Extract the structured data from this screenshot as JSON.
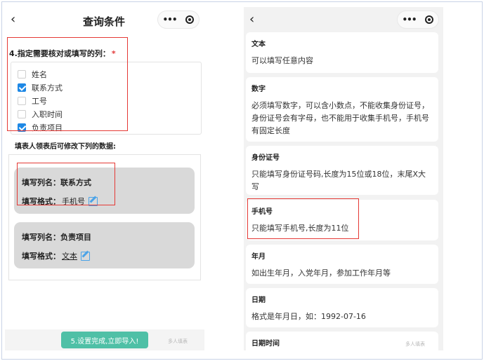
{
  "left": {
    "nav": {
      "back_icon": "back-arrow-icon",
      "title": "查询条件",
      "capsule_more": "menu-dots-icon",
      "capsule_close": "target-icon"
    },
    "question": {
      "label": "4.指定需要核对或填写的列：",
      "required_mark": "*"
    },
    "columns": [
      {
        "label": "姓名",
        "checked": false
      },
      {
        "label": "联系方式",
        "checked": true
      },
      {
        "label": "工号",
        "checked": false
      },
      {
        "label": "入职时间",
        "checked": false
      },
      {
        "label": "负责项目",
        "checked": true
      }
    ],
    "modify_label": "填表人领表后可修改下列的数据:",
    "cards": [
      {
        "name_label": "填写列名：",
        "name_value": "联系方式",
        "format_label": "填写格式：",
        "format_value": "手机号",
        "edit_icon": "edit-icon"
      },
      {
        "name_label": "填写列名：",
        "name_value": "负责项目",
        "format_label": "填写格式：",
        "format_value": "文本",
        "edit_icon": "edit-icon"
      }
    ],
    "import_button": "5.设置完成,立即导入!",
    "watermark": "多人填表"
  },
  "right": {
    "nav": {
      "back_icon": "back-arrow-icon",
      "capsule_more": "menu-dots-icon",
      "capsule_close": "target-icon"
    },
    "types": [
      {
        "title": "文本",
        "desc": "可以填写任意内容"
      },
      {
        "title": "数字",
        "desc": "必须填写数字，可以含小数点，不能收集身份证号，身份证号会有字母，也不能用于收集手机号，手机号有固定长度"
      },
      {
        "title": "身份证号",
        "desc": "只能填写身份证号码,长度为15位或18位，末尾X大写"
      },
      {
        "title": "手机号",
        "desc": "只能填写手机号,长度为11位"
      },
      {
        "title": "年月",
        "desc": "如出生年月，入党年月，参加工作年月等"
      },
      {
        "title": "日期",
        "desc": "格式是年月日，如：1992-07-16"
      },
      {
        "title": "日期时间",
        "desc": ""
      }
    ],
    "watermark": "多人填表"
  },
  "colors": {
    "accent_blue": "#1e88e5",
    "import_green": "#4fc0a6",
    "highlight_red": "#e53935",
    "card_gray": "#d9d9d9"
  }
}
